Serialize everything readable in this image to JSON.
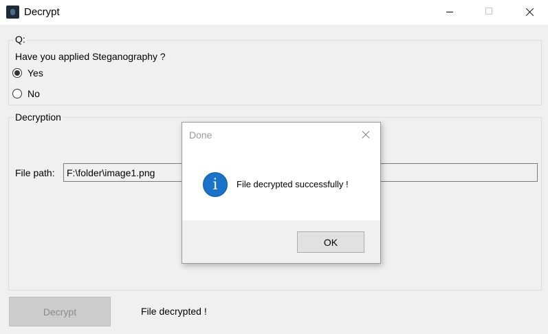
{
  "window": {
    "title": "Decrypt",
    "icon": "app-icon"
  },
  "question_group": {
    "legend": "Q:",
    "question": "Have you applied Steganography ?",
    "options": [
      {
        "label": "Yes",
        "checked": true
      },
      {
        "label": "No",
        "checked": false
      }
    ]
  },
  "decryption_group": {
    "legend": "Decryption",
    "file_path_label": "File path:",
    "file_path_value": "F:\\folder\\image1.png"
  },
  "decrypt_button": {
    "label": "Decrypt",
    "enabled": false
  },
  "status": "File decrypted !",
  "dialog": {
    "title": "Done",
    "icon": "info-icon",
    "message": "File decrypted successfully !",
    "ok_label": "OK"
  },
  "colors": {
    "info_blue": "#1a73c8",
    "disabled_button": "#cccccc",
    "dialog_title": "#9b9b9b"
  }
}
